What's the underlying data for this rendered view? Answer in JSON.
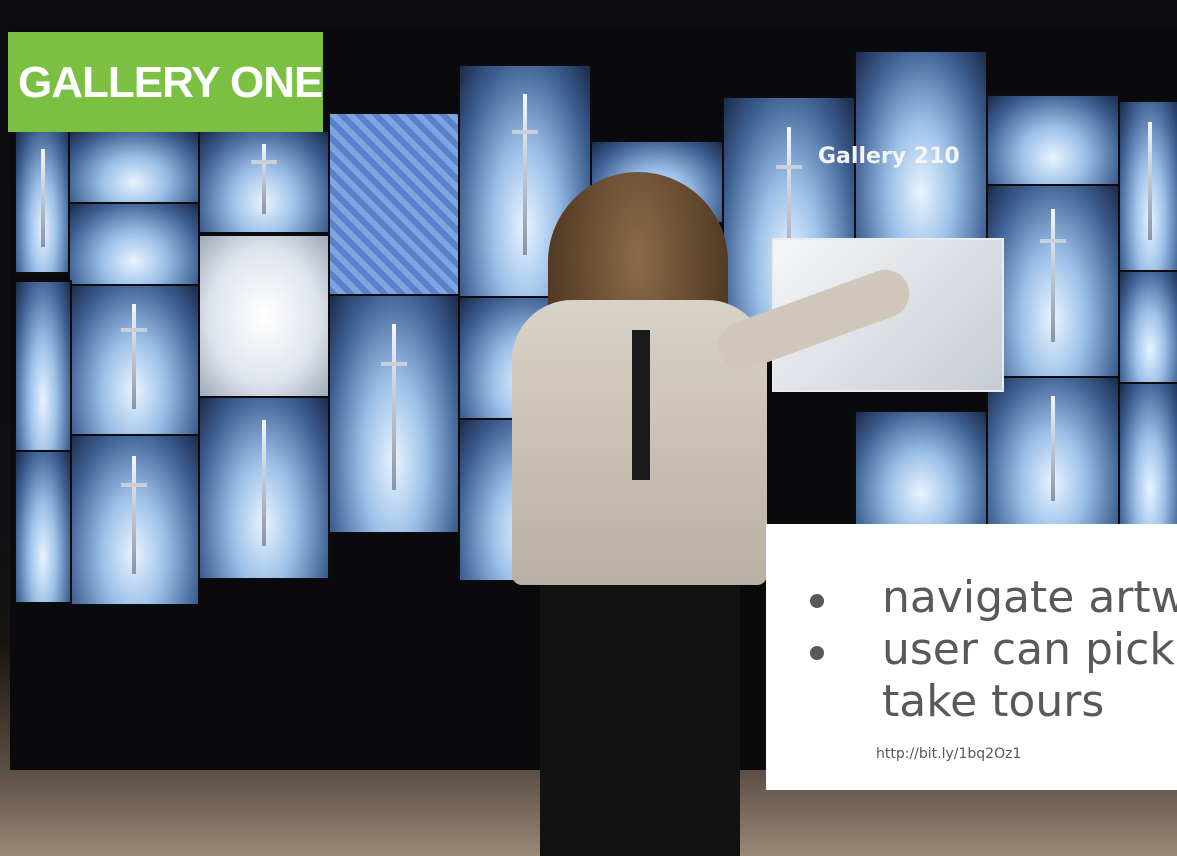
{
  "logo": {
    "text": "GALLERY ONE",
    "color": "#7bc042"
  },
  "photo_screen_text": "Gallery 210",
  "caption": {
    "bullets": [
      "navigate artwo",
      "user can pick a",
      "take tours"
    ],
    "link": "http://bit.ly/1bq2Oz1"
  }
}
